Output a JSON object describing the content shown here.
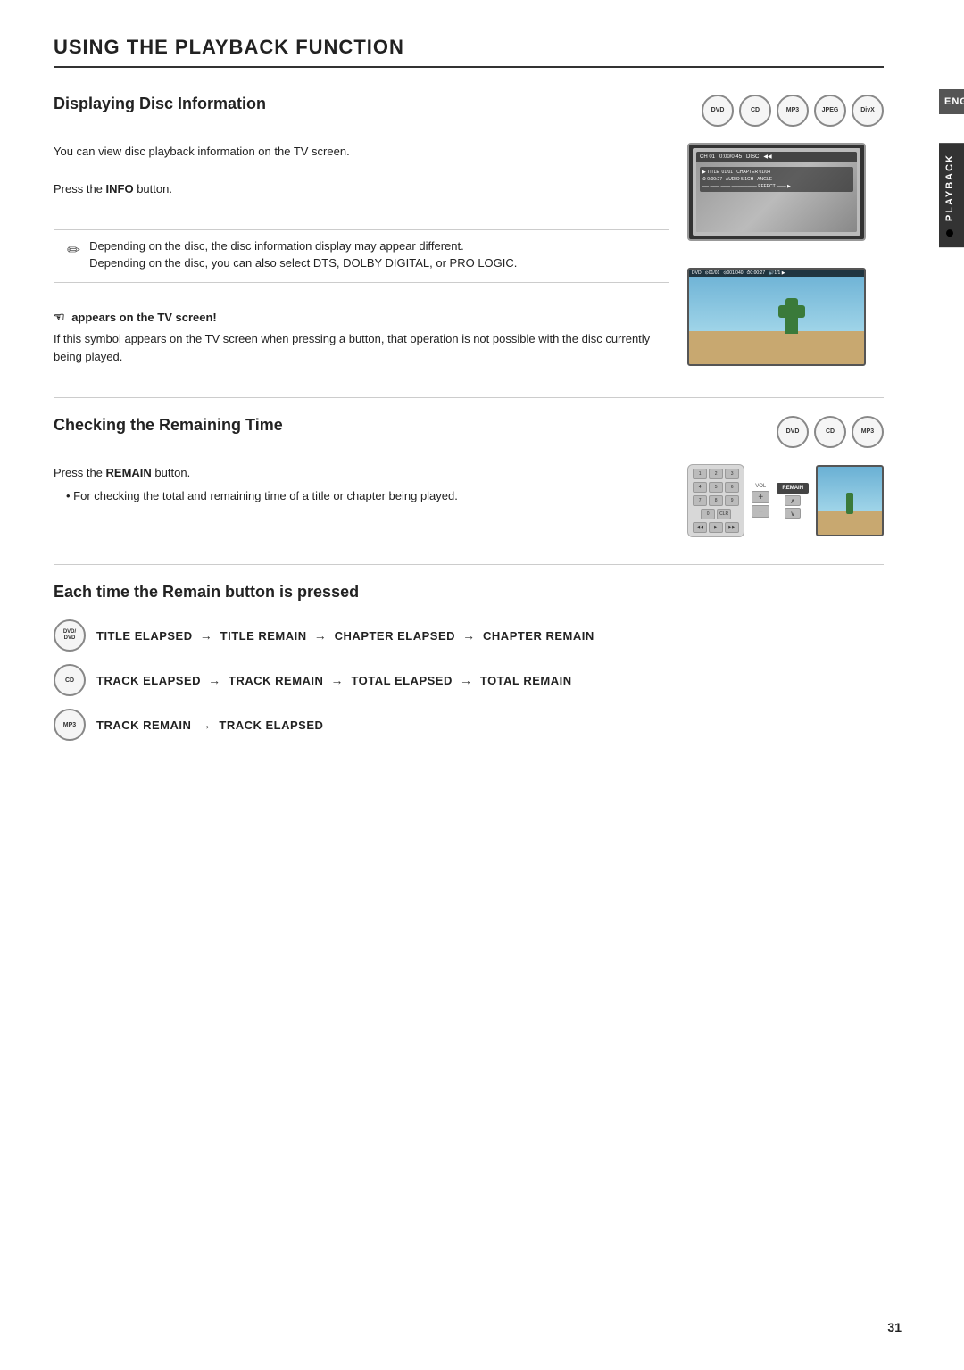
{
  "page": {
    "number": "31",
    "lang_tab": "ENG",
    "side_tab": "PLAYBACK"
  },
  "section": {
    "title": "USING THE PLAYBACK FUNCTION",
    "subsections": [
      {
        "id": "displaying-disc",
        "title": "Displaying Disc Information",
        "disc_icons": [
          "DVD",
          "CD",
          "MP3",
          "JPEG",
          "DivX"
        ],
        "body_text": "You can view disc playback information  on the TV screen.",
        "press_text": "Press the ",
        "press_bold": "INFO",
        "press_suffix": " button.",
        "note_lines": [
          "Depending on the disc, the disc information display may appear different.",
          "Depending on the disc, you can also select DTS, DOLBY DIGITAL, or PRO LOGIC."
        ],
        "appears_title": "appears on the TV screen!",
        "appears_body": "If this symbol appears on the TV screen when pressing a button, that operation is not possible with the disc currently being played."
      },
      {
        "id": "checking-remaining",
        "title": "Checking the Remaining Time",
        "disc_icons": [
          "DVD",
          "CD",
          "MP3"
        ],
        "press_text": "Press the ",
        "press_bold": "REMAIN",
        "press_suffix": " button.",
        "bullet": "For checking the total and remaining time of a title or chapter being played."
      }
    ]
  },
  "remain_section": {
    "title": "Each time the Remain button is pressed",
    "rows": [
      {
        "icon_label": "DVD/DVD",
        "sequence": "TITLE ELAPSED → TITLE REMAIN → CHAPTER ELAPSED → CHAPTER REMAIN"
      },
      {
        "icon_label": "CD",
        "sequence": "TRACK ELAPSED → TRACK REMAIN → TOTAL ELAPSED → TOTAL REMAIN"
      },
      {
        "icon_label": "MP3",
        "sequence": "TRACK REMAIN → TRACK ELAPSED"
      }
    ]
  }
}
